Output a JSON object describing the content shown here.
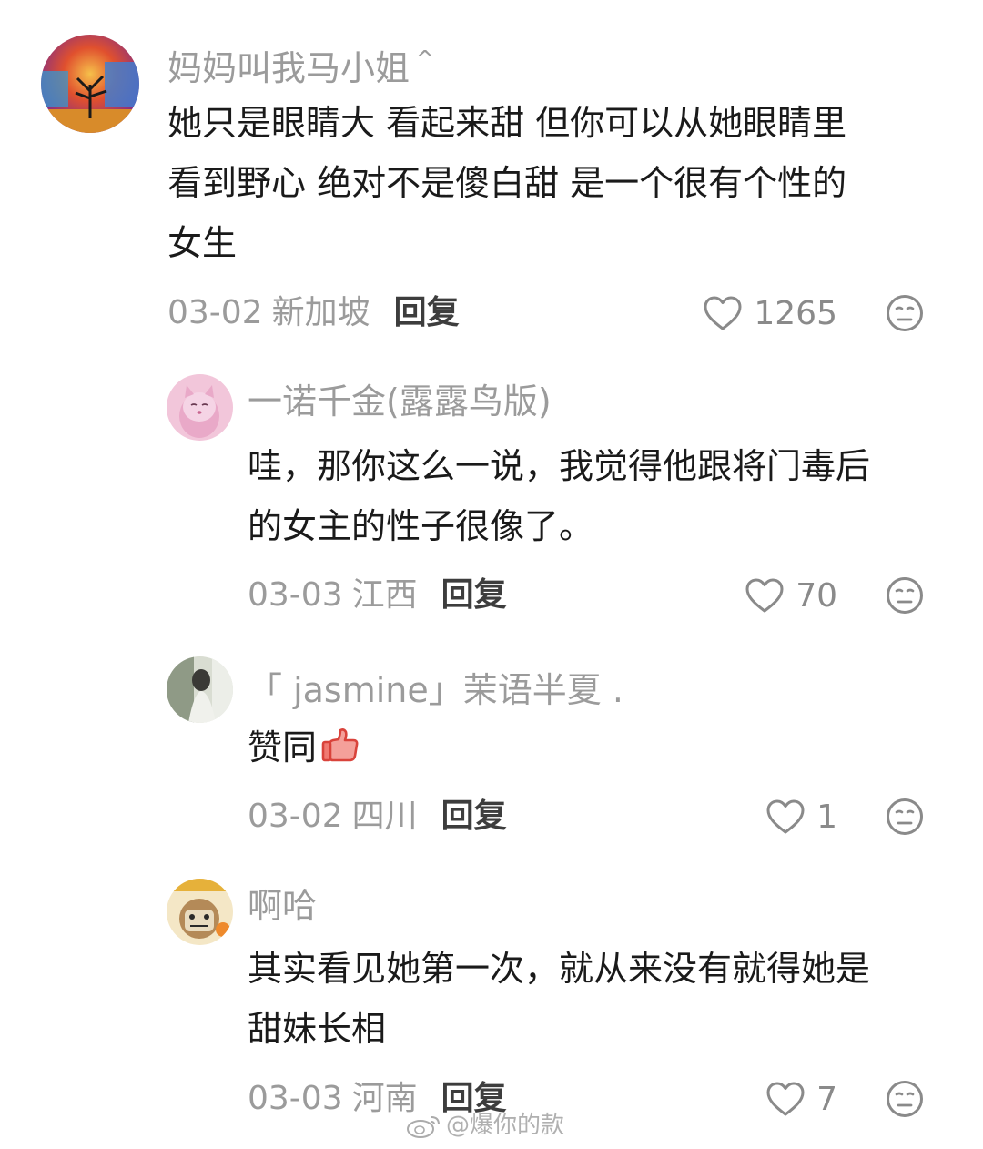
{
  "colors": {
    "username": "#9b9b9b",
    "content": "#1a1a1a",
    "meta": "#9b9b9b",
    "reply": "#3d3d3d",
    "icon": "#8a8a8a"
  },
  "comments": [
    {
      "username": "妈妈叫我马小姐",
      "username_suffix": "^",
      "lines": [
        "她只是眼睛大 看起来甜 但你可以从她眼睛里",
        "看到野心 绝对不是傻白甜 是一个很有个性的",
        "女生"
      ],
      "date": "03-02",
      "location": "新加坡",
      "reply_label": "回复",
      "likes": "1265",
      "like_icon": "heart-icon",
      "dislike_icon": "dislike-face-icon"
    },
    {
      "username": "一诺千金(露露鸟版)",
      "lines": [
        "哇，那你这么一说，我觉得他跟将门毒后",
        "的女主的性子很像了。"
      ],
      "date": "03-03",
      "location": "江西",
      "reply_label": "回复",
      "likes": "70",
      "like_icon": "heart-icon",
      "dislike_icon": "dislike-face-icon"
    },
    {
      "username": "「 jasmine」茉语半夏 .",
      "lines": [
        "赞同"
      ],
      "emoji": "thumbs-up-emoji",
      "date": "03-02",
      "location": "四川",
      "reply_label": "回复",
      "likes": "1",
      "like_icon": "heart-icon",
      "dislike_icon": "dislike-face-icon"
    },
    {
      "username": "啊哈",
      "lines": [
        "其实看见她第一次，就从来没有就得她是",
        "甜妹长相"
      ],
      "date": "03-03",
      "location": "河南",
      "reply_label": "回复",
      "likes": "7",
      "like_icon": "heart-icon",
      "dislike_icon": "dislike-face-icon"
    }
  ],
  "watermark": {
    "text": "@爆你的款",
    "icon": "weibo-logo-icon"
  }
}
